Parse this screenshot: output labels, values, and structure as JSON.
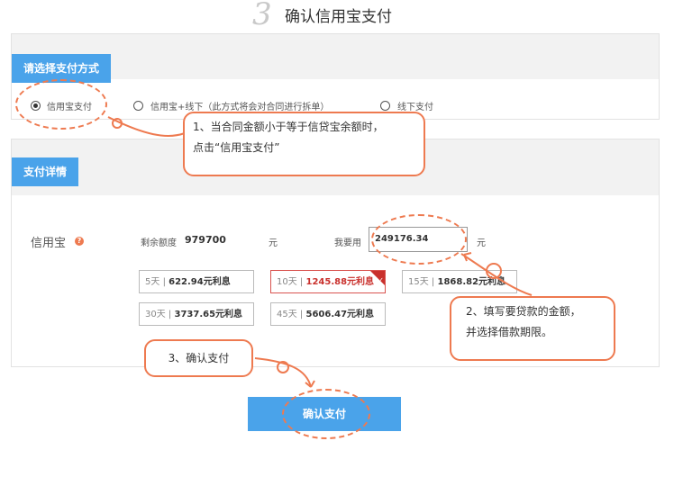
{
  "header": {
    "step_number": "3",
    "title": "确认信用宝支付"
  },
  "payment_method": {
    "section_title": "请选择支付方式",
    "options": [
      {
        "label": "信用宝支付",
        "selected": true
      },
      {
        "label": "信用宝+线下（此方式将会对合同进行拆单）",
        "selected": false
      },
      {
        "label": "线下支付",
        "selected": false
      }
    ]
  },
  "details": {
    "section_title": "支付详情",
    "credit_label": "信用宝",
    "help_icon": "?",
    "remaining_label": "剩余额度",
    "remaining_value": "979700",
    "remaining_unit": "元",
    "use_label": "我要用",
    "use_value": "249176.34",
    "use_unit": "元",
    "terms": [
      {
        "days": "5天",
        "sep": "|",
        "amount": "622.94元利息",
        "selected": false
      },
      {
        "days": "10天",
        "sep": "|",
        "amount": "1245.88元利息",
        "selected": true
      },
      {
        "days": "15天",
        "sep": "|",
        "amount": "1868.82元利息",
        "selected": false
      },
      {
        "days": "30天",
        "sep": "|",
        "amount": "3737.65元利息",
        "selected": false
      },
      {
        "days": "45天",
        "sep": "|",
        "amount": "5606.47元利息",
        "selected": false
      }
    ],
    "confirm_label": "确认支付"
  },
  "callouts": {
    "note1_line1": "1、当合同金额小于等于信贷宝余额时，",
    "note1_line2": "点击“信用宝支付”",
    "note2_line1": "2、填写要贷款的金额，",
    "note2_line2": "并选择借款期限。",
    "note3": "3、确认支付"
  },
  "colors": {
    "accent_blue": "#4aa3ea",
    "annotation_orange": "#ee7a50",
    "selected_red": "#c9302c"
  }
}
